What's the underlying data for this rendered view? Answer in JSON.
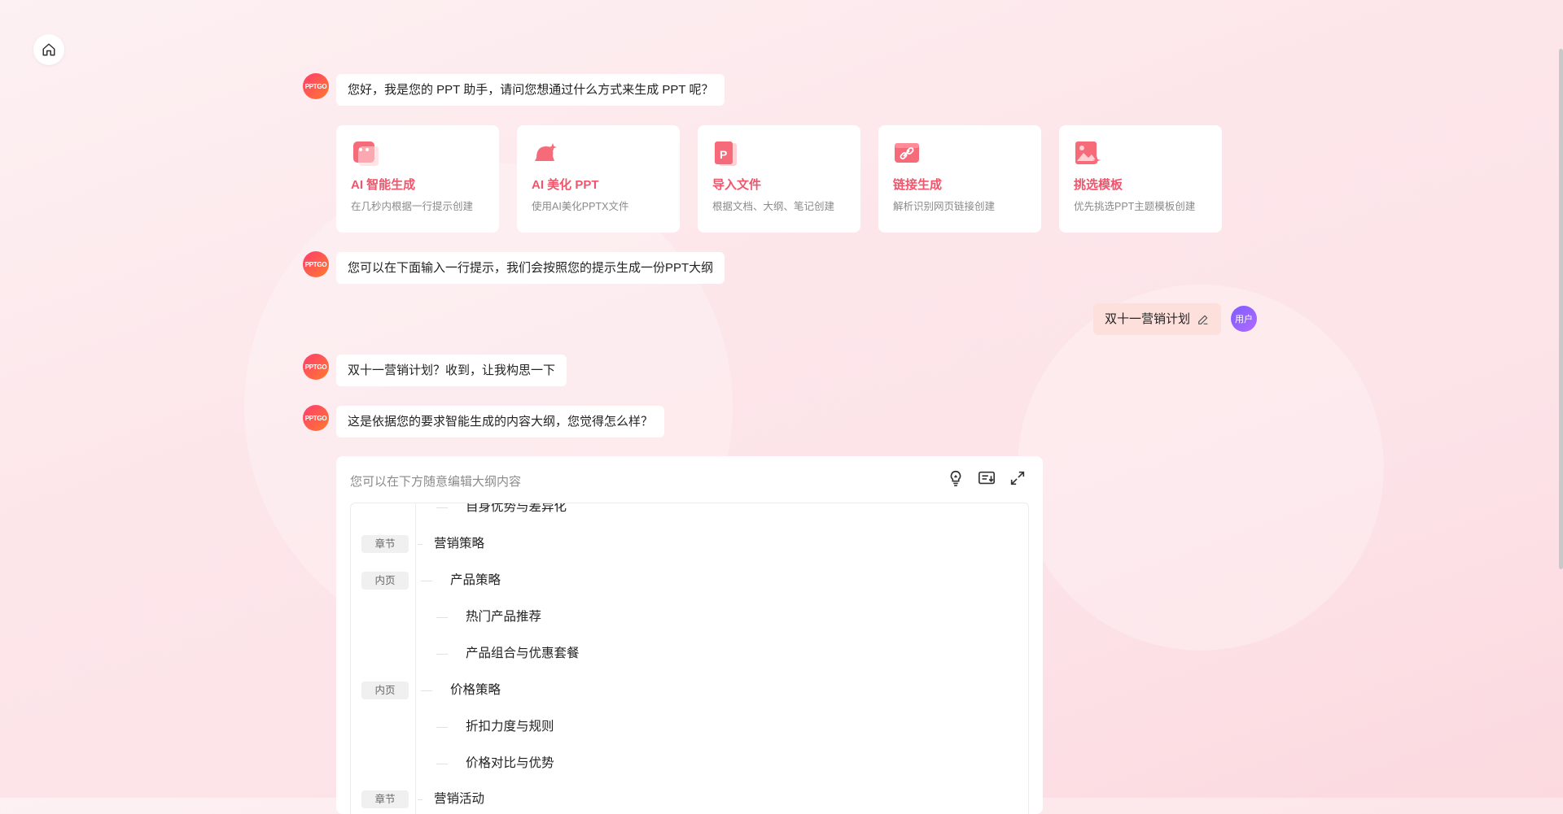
{
  "assistant_avatar_label": "PPTGO",
  "user_avatar_label": "用户",
  "messages": {
    "greeting": "您好，我是您的 PPT 助手，请问您想通过什么方式来生成 PPT 呢？",
    "prompt_hint": "您可以在下面输入一行提示，我们会按照您的提示生成一份PPT大纲",
    "user_input": "双十一营销计划",
    "ack": "双十一营销计划？收到，让我构思一下",
    "outline_intro": "这是依据您的要求智能生成的内容大纲，您觉得怎么样？"
  },
  "cards": [
    {
      "icon": "chat-icon",
      "title": "AI 智能生成",
      "desc": "在几秒内根据一行提示创建"
    },
    {
      "icon": "bell-sparkle-icon",
      "title": "AI 美化 PPT",
      "desc": "使用AI美化PPTX文件"
    },
    {
      "icon": "ppt-file-icon",
      "title": "导入文件",
      "desc": "根据文档、大纲、笔记创建"
    },
    {
      "icon": "link-icon",
      "title": "链接生成",
      "desc": "解析识别网页链接创建"
    },
    {
      "icon": "image-template-icon",
      "title": "挑选模板",
      "desc": "优先挑选PPT主题模板创建"
    }
  ],
  "outline": {
    "hint": "您可以在下方随意编辑大纲内容",
    "rows": [
      {
        "tag": "",
        "text": "自身优势与差异化",
        "level": 2
      },
      {
        "tag": "章节",
        "text": "营销策略",
        "level": 0
      },
      {
        "tag": "内页",
        "text": "产品策略",
        "level": 1
      },
      {
        "tag": "",
        "text": "热门产品推荐",
        "level": 2
      },
      {
        "tag": "",
        "text": "产品组合与优惠套餐",
        "level": 2
      },
      {
        "tag": "内页",
        "text": "价格策略",
        "level": 1
      },
      {
        "tag": "",
        "text": "折扣力度与规则",
        "level": 2
      },
      {
        "tag": "",
        "text": "价格对比与优势",
        "level": 2
      },
      {
        "tag": "章节",
        "text": "营销活动",
        "level": 0
      }
    ]
  },
  "colors": {
    "accent": "#f2546b",
    "user_bubble": "#fde0dc"
  }
}
